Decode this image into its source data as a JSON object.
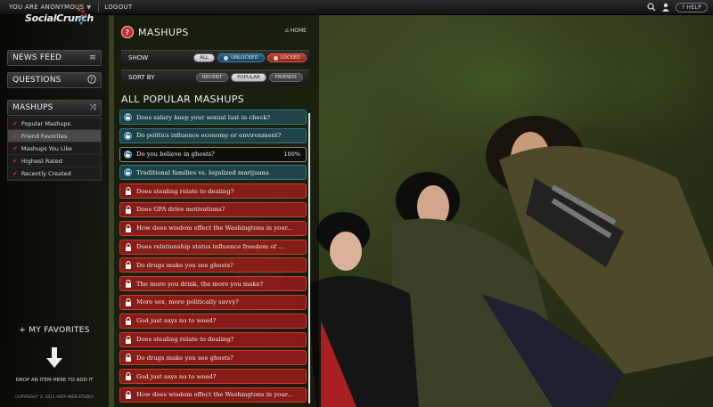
{
  "topbar": {
    "user_label": "YOU ARE ANONYMOUS",
    "logout_label": "LOGOUT",
    "help_label": "HELP"
  },
  "sidebar": {
    "logo": "SocialCrunch",
    "nav": [
      {
        "label": "NEWS FEED",
        "icon": "menu-icon"
      },
      {
        "label": "QUESTIONS",
        "icon": "question-circle-icon"
      },
      {
        "label": "MASHUPS",
        "icon": "shuffle-icon"
      }
    ],
    "submenu": [
      {
        "label": "Popular Mashups",
        "selected": false
      },
      {
        "label": "Friend Favorites",
        "selected": true
      },
      {
        "label": "Mashups You Like",
        "selected": false
      },
      {
        "label": "Highest Rated",
        "selected": false
      },
      {
        "label": "Recently Created",
        "selected": false
      }
    ],
    "favorites_label": "+ MY FAVORITES",
    "drop_text": "DROP AN ITEM HERE TO ADD IT",
    "copyright": "COPYRIGHT © 2011 AKTA WEB STUDIO"
  },
  "panel": {
    "title": "MASHUPS",
    "home_label": "HOME",
    "show": {
      "label": "SHOW",
      "options": [
        {
          "label": "ALL",
          "style": "active"
        },
        {
          "label": "UNLOCKED",
          "style": "blue"
        },
        {
          "label": "LOCKED",
          "style": "red"
        }
      ]
    },
    "sort": {
      "label": "SORT BY",
      "options": [
        {
          "label": "RECENT",
          "style": ""
        },
        {
          "label": "POPULAR",
          "style": "active"
        },
        {
          "label": "FRIENDS",
          "style": ""
        }
      ]
    },
    "list_title": "ALL POPULAR MASHUPS",
    "rows": [
      {
        "text": "Does salary keep your sexual lust in check?",
        "state": "unlocked"
      },
      {
        "text": "Do politics influence economy or environment?",
        "state": "unlocked"
      },
      {
        "text": "Do you believe in ghosts?",
        "state": "selected",
        "percent": "100%"
      },
      {
        "text": "Traditional families vs. legalized marijuana",
        "state": "unlocked"
      },
      {
        "text": "Does stealing relate to dealing?",
        "state": "locked"
      },
      {
        "text": "Does GPA drive motivations?",
        "state": "locked"
      },
      {
        "text": "How does wisdom effect the Washingtons in your...",
        "state": "locked"
      },
      {
        "text": "Does relationship status influence freedom of ...",
        "state": "locked"
      },
      {
        "text": "Do drugs make you see ghosts?",
        "state": "locked"
      },
      {
        "text": "The more you drink, the more you make?",
        "state": "locked"
      },
      {
        "text": "More sex, more politically savvy?",
        "state": "locked"
      },
      {
        "text": "God just says no to weed?",
        "state": "locked"
      },
      {
        "text": "Does stealing relate to dealing?",
        "state": "locked"
      },
      {
        "text": "Do drugs make you see ghosts?",
        "state": "locked"
      },
      {
        "text": "God just says no to weed?",
        "state": "locked"
      },
      {
        "text": "How does wisdom effect the Washingtons in your...",
        "state": "locked"
      }
    ]
  },
  "colors": {
    "accent_red": "#c62c22",
    "unlocked_blue": "#1d5f80"
  }
}
